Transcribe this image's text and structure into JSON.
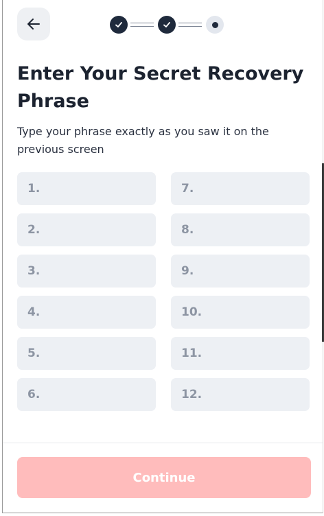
{
  "header": {
    "back_icon": "arrow-left-icon",
    "stepper": {
      "steps": [
        {
          "state": "completed",
          "icon": "check-icon"
        },
        {
          "state": "completed",
          "icon": "check-icon"
        },
        {
          "state": "current",
          "icon": "dot-icon"
        }
      ]
    }
  },
  "main": {
    "title": "Enter Your Secret Recovery Phrase",
    "subtitle": "Type your phrase exactly as you saw it on the previous screen",
    "words": [
      {
        "placeholder": "1."
      },
      {
        "placeholder": "2."
      },
      {
        "placeholder": "3."
      },
      {
        "placeholder": "4."
      },
      {
        "placeholder": "5."
      },
      {
        "placeholder": "6."
      },
      {
        "placeholder": "7."
      },
      {
        "placeholder": "8."
      },
      {
        "placeholder": "9."
      },
      {
        "placeholder": "10."
      },
      {
        "placeholder": "11."
      },
      {
        "placeholder": "12."
      }
    ]
  },
  "footer": {
    "continue_label": "Continue",
    "continue_disabled": true
  },
  "colors": {
    "primary_dark": "#1f2a3c",
    "field_background": "#edf0f4",
    "placeholder_text": "#8d95a3",
    "continue_disabled_bg": "#ffbcbc"
  }
}
